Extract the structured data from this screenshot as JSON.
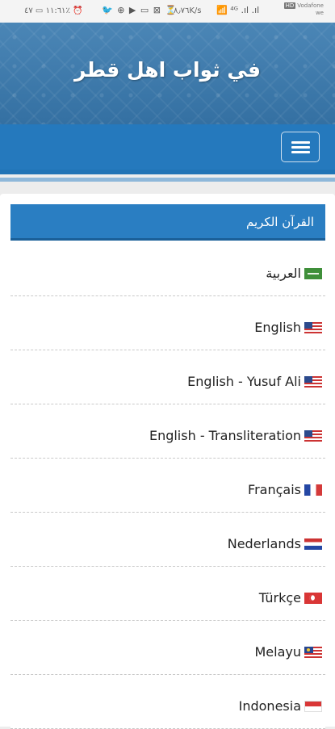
{
  "status_bar": {
    "time": "١١:٦١",
    "left_icons": "▭ ٤٧٪ ⏰",
    "notif_icons": "🐦 ⊕ ▶ ▭ ⊠ ⏳",
    "speed": "٨٫٧٦K/s",
    "signal_icons": "📶 ⁴ᴳ .ıl .ıl",
    "carrier_badge": "HD",
    "carrier_name": "Vodafone",
    "carrier_sub": "we"
  },
  "header": {
    "site_title": "في ثواب اهل قطر"
  },
  "nav": {
    "menu_icon": "hamburger-menu-icon"
  },
  "section": {
    "title": "القرآن الكريم",
    "items": [
      {
        "label": "العربية",
        "flag": "saudi-arabia-flag-icon"
      },
      {
        "label": "English",
        "flag": "usa-flag-icon"
      },
      {
        "label": "English - Yusuf Ali",
        "flag": "usa-flag-icon"
      },
      {
        "label": "English - Transliteration",
        "flag": "usa-flag-icon"
      },
      {
        "label": "Français",
        "flag": "france-flag-icon"
      },
      {
        "label": "Nederlands",
        "flag": "netherlands-flag-icon"
      },
      {
        "label": "Türkçe",
        "flag": "turkey-flag-icon"
      },
      {
        "label": "Melayu",
        "flag": "malaysia-flag-icon"
      },
      {
        "label": "Indonesia",
        "flag": "indonesia-flag-icon"
      }
    ]
  },
  "colors": {
    "nav_blue": "#2579bd",
    "header_bar": "#2a7ec2",
    "banner": "#3a77a8"
  }
}
